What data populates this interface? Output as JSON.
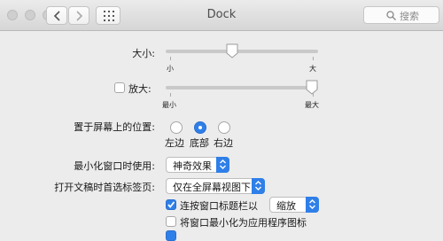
{
  "window": {
    "title": "Dock",
    "search_placeholder": "搜索"
  },
  "icons": {
    "close": "traffic-light",
    "minimize": "traffic-light",
    "zoom": "traffic-light",
    "back": "chevron-left",
    "forward": "chevron-right",
    "grid": "grid-dots",
    "search": "magnifier"
  },
  "size": {
    "label": "大小:",
    "min_label": "小",
    "max_label": "大",
    "value": 0.4
  },
  "magnification": {
    "label": "放大:",
    "checked": false,
    "min_label": "最小",
    "max_label": "最大",
    "value": 1.0
  },
  "position": {
    "label": "置于屏幕上的位置:",
    "options": [
      "左边",
      "底部",
      "右边"
    ],
    "selected": "底部"
  },
  "minimize_effect": {
    "label": "最小化窗口时使用:",
    "value": "神奇效果"
  },
  "prefer_tabs": {
    "label": "打开文稿时首选标签页:",
    "value": "仅在全屏幕视图下"
  },
  "double_click": {
    "label": "连按窗口标题栏以",
    "checked": true,
    "value": "缩放"
  },
  "minimize_into_app": {
    "label": "将窗口最小化为应用程序图标",
    "checked": false
  },
  "colors": {
    "accent": "#2f7fe8"
  }
}
